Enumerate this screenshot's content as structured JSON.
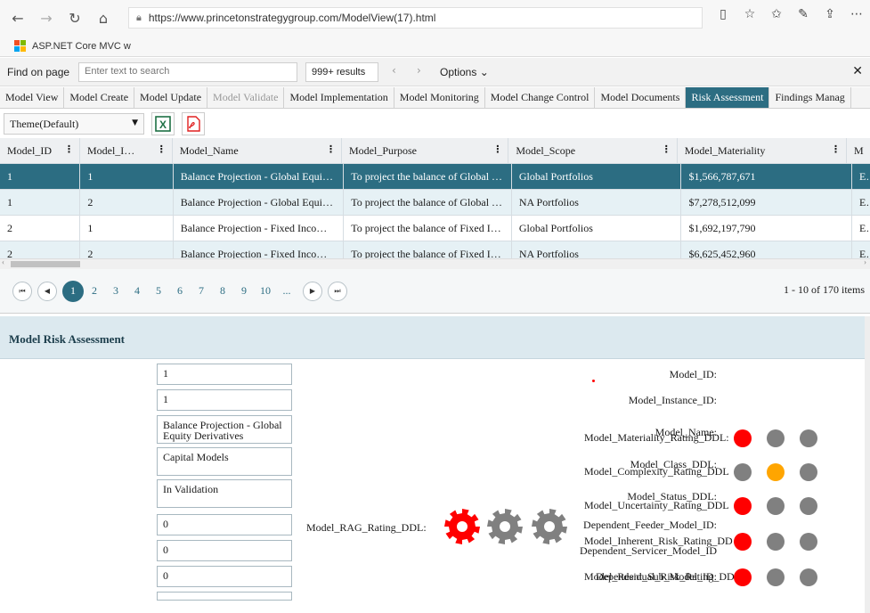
{
  "browser": {
    "url": "https://www.princetonstrategygroup.com/ModelView(17).html",
    "favorite": "ASP.NET Core MVC w",
    "find_label": "Find on page",
    "find_placeholder": "Enter text to search",
    "find_results": "999+ results",
    "find_options": "Options"
  },
  "app_tabs": [
    {
      "label": "Model View",
      "state": "normal"
    },
    {
      "label": "Model Create",
      "state": "normal"
    },
    {
      "label": "Model Update",
      "state": "normal"
    },
    {
      "label": "Model Validate",
      "state": "disabled"
    },
    {
      "label": "Model Implementation",
      "state": "normal"
    },
    {
      "label": "Model Monitoring",
      "state": "normal"
    },
    {
      "label": "Model Change Control",
      "state": "normal"
    },
    {
      "label": "Model Documents",
      "state": "normal"
    },
    {
      "label": "Risk Assessment",
      "state": "active"
    },
    {
      "label": "Findings Manag",
      "state": "normal"
    }
  ],
  "theme": "Theme(Default)",
  "grid": {
    "columns": [
      "Model_ID",
      "Model_I…",
      "Model_Name",
      "Model_Purpose",
      "Model_Scope",
      "Model_Materiality",
      "M"
    ],
    "rows": [
      [
        "1",
        "1",
        "Balance Projection - Global Equi…",
        "To project the balance of Global …",
        "Global Portfolios",
        "$1,566,787,671",
        "E"
      ],
      [
        "1",
        "2",
        "Balance Projection - Global Equi…",
        "To project the balance of Global …",
        "NA Portfolios",
        "$7,278,512,099",
        "E"
      ],
      [
        "2",
        "1",
        "Balance Projection - Fixed Inco…",
        "To project the balance of Fixed I…",
        "Global Portfolios",
        "$1,692,197,790",
        "E"
      ],
      [
        "2",
        "2",
        "Balance Projection - Fixed Inco…",
        "To project the balance of Fixed I…",
        "NA Portfolios",
        "$6,625,452,960",
        "E"
      ]
    ]
  },
  "pager": {
    "pages": [
      "1",
      "2",
      "3",
      "4",
      "5",
      "6",
      "7",
      "8",
      "9",
      "10",
      "..."
    ],
    "info": "1 - 10 of 170 items"
  },
  "panel": {
    "title": "Model Risk Assessment",
    "fields": [
      {
        "label": "Model_ID:",
        "value": "1"
      },
      {
        "label": "Model_Instance_ID:",
        "value": "1"
      },
      {
        "label": "Model_Name:",
        "value": "Balance Projection - Global Equity Derivatives"
      },
      {
        "label": "Model_Class_DDL:",
        "value": "Capital Models"
      },
      {
        "label": "Model_Status_DDL:",
        "value": "In Validation"
      },
      {
        "label": "Dependent_Feeder_Model_ID:",
        "value": "0"
      },
      {
        "label": "Dependent_Servicer_Model_ID",
        "value": "0"
      },
      {
        "label": "Dependent_Sub_Model_ID:",
        "value": "0"
      }
    ],
    "rag_label": "Model_RAG_Rating_DDL:",
    "ratings": [
      {
        "label": "Model_Materiality_Rating_DDL:",
        "dots": [
          "#ff0000",
          "#808080",
          "#808080"
        ]
      },
      {
        "label": "Model_Complexity_Rating_DDL",
        "dots": [
          "#808080",
          "#ffa500",
          "#808080"
        ]
      },
      {
        "label": "Model_Uncertainty_Rating_DDL",
        "dots": [
          "#ff0000",
          "#808080",
          "#808080"
        ]
      },
      {
        "label": "Model_Inherent_Risk_Rating_DD",
        "dots": [
          "#ff0000",
          "#808080",
          "#808080"
        ]
      },
      {
        "label": "Model_Residual_Risk_Rating_DD",
        "dots": [
          "#ff0000",
          "#808080",
          "#808080"
        ]
      }
    ],
    "gear_colors": [
      "#ff0000",
      "#808080",
      "#808080"
    ]
  }
}
